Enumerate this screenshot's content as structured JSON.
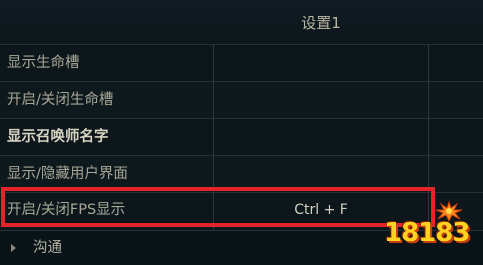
{
  "header": {
    "column_title": "设置1"
  },
  "rows": [
    {
      "label": "显示生命槽",
      "value": ""
    },
    {
      "label": "开启/关闭生命槽",
      "value": ""
    },
    {
      "label": "显示召唤师名字",
      "value": ""
    },
    {
      "label": "显示/隐藏用户界面",
      "value": ""
    },
    {
      "label": "开启/关闭FPS显示",
      "value": "Ctrl + F"
    }
  ],
  "section": {
    "label": "沟通"
  },
  "watermark": {
    "text": "18183"
  },
  "colors": {
    "highlight": "#e5232a",
    "background": "#0b1419",
    "text": "#a8a697"
  }
}
